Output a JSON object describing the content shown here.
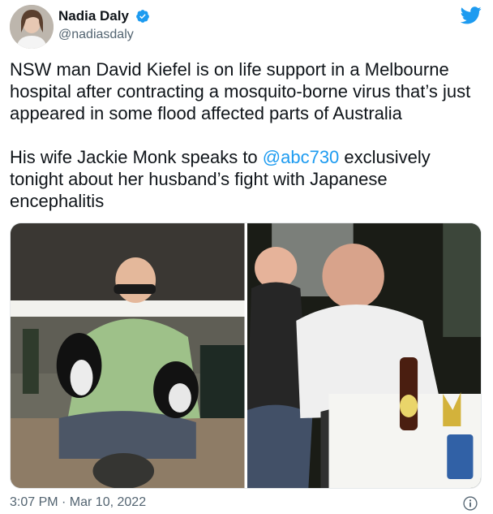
{
  "author": {
    "display_name": "Nadia Daly",
    "handle": "@nadiasdaly",
    "avatar_icon": "user-avatar",
    "verified_icon": "verified-badge-icon"
  },
  "brand": {
    "icon": "twitter-bird-icon",
    "color": "#1d9bf0"
  },
  "tweet": {
    "paragraph1": "NSW man David Kiefel is on life support in a Melbourne hospital after contracting a mosquito-borne virus that’s just appeared in some flood affected parts of Australia",
    "paragraph2_before": "His wife Jackie Monk speaks to ",
    "mention": "@abc730",
    "paragraph2_after": " exclusively tonight about her husband’s fight with Japanese encephalitis"
  },
  "media": {
    "photo1": "photo-man-with-dogs",
    "photo2": "photo-couple-at-table"
  },
  "footer": {
    "timestamp": "3:07 PM · Mar 10, 2022",
    "info_icon": "info-icon"
  }
}
